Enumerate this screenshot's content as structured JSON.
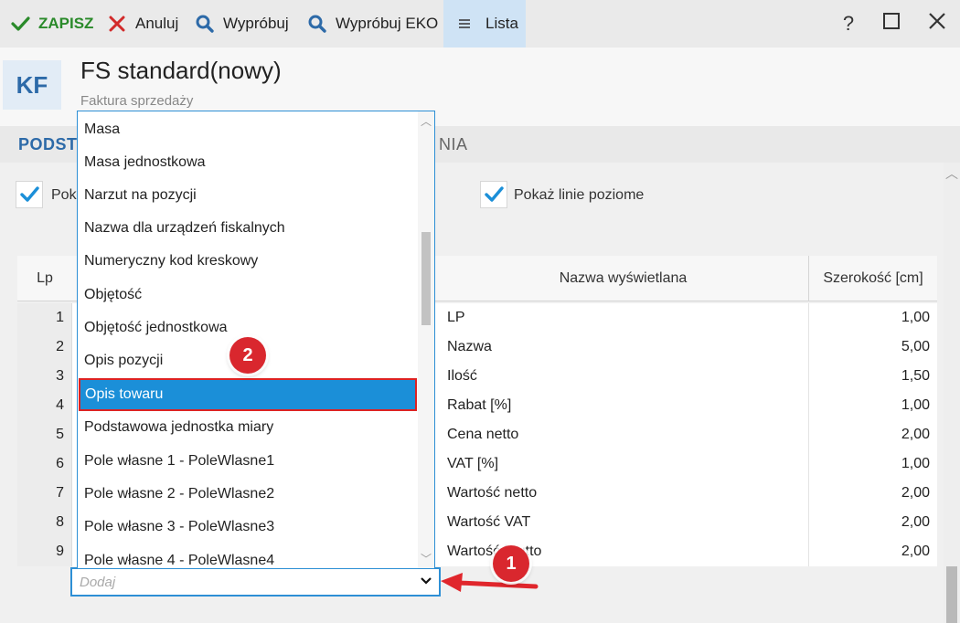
{
  "toolbar": {
    "save_label": "ZAPISZ",
    "cancel_label": "Anuluj",
    "try_label": "Wypróbuj",
    "try_eko_label": "Wypróbuj EKO",
    "list_label": "Lista",
    "help_label": "?",
    "colors": {
      "save": "#2a8a2a",
      "cancel": "#d22b2b",
      "search": "#2d6aa8",
      "list_bg": "#cfe3f5"
    }
  },
  "header": {
    "badge": "KF",
    "title": "FS standard(nowy)",
    "subtitle": "Faktura sprzedaży"
  },
  "tabs": [
    {
      "label": "PODST"
    },
    {
      "label": "NIA"
    }
  ],
  "options": {
    "show_vertical_partial": "Poka",
    "show_horizontal": "Pokaż linie poziome"
  },
  "grid": {
    "headers": {
      "lp": "Lp",
      "display_name": "Nazwa wyświetlana",
      "width": "Szerokość [cm]"
    },
    "rows": [
      {
        "lp": "1",
        "name": "LP",
        "width": "1,00"
      },
      {
        "lp": "2",
        "name": "Nazwa",
        "width": "5,00"
      },
      {
        "lp": "3",
        "name": "Ilość",
        "width": "1,50"
      },
      {
        "lp": "4",
        "name": "Rabat [%]",
        "width": "1,00"
      },
      {
        "lp": "5",
        "name": "Cena netto",
        "width": "2,00"
      },
      {
        "lp": "6",
        "name": "VAT [%]",
        "width": "1,00"
      },
      {
        "lp": "7",
        "name": "Wartość netto",
        "width": "2,00"
      },
      {
        "lp": "8",
        "name": "Wartość VAT",
        "width": "2,00"
      },
      {
        "lp": "9",
        "name": "Wartość brutto",
        "width": "2,00"
      }
    ]
  },
  "add_field": {
    "placeholder": "Dodaj"
  },
  "dropdown": {
    "items": [
      "Masa",
      "Masa jednostkowa",
      "Narzut na pozycji",
      "Nazwa dla urządzeń fiskalnych",
      "Numeryczny kod kreskowy",
      "Objętość",
      "Objętość jednostkowa",
      "Opis pozycji",
      "Opis towaru",
      "Podstawowa jednostka miary",
      "Pole własne 1 - PoleWlasne1",
      "Pole własne 2 - PoleWlasne2",
      "Pole własne 3 - PoleWlasne3",
      "Pole własne 4 - PoleWlasne4"
    ],
    "selected": "Opis towaru"
  },
  "annotations": {
    "badge1": "1",
    "badge2": "2",
    "color": "#d9272e"
  }
}
